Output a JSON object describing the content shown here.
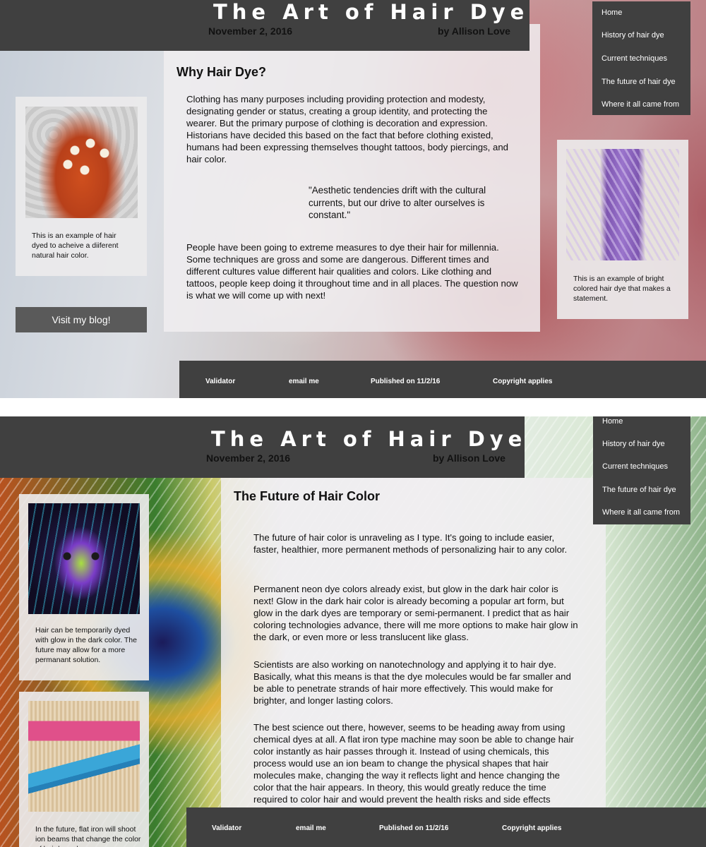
{
  "shot1": {
    "header": {
      "title": "The Art of Hair Dye",
      "date": "November 2, 2016",
      "author": "by Allison Love"
    },
    "nav": {
      "items": [
        "Home",
        "History of hair dye",
        "Current techniques",
        "The future of hair dye",
        "Where it all came from"
      ]
    },
    "left_card": {
      "caption": "This is an example of hair dyed to acheive a diiferent natural hair color."
    },
    "blog_button": "Visit my blog!",
    "main": {
      "title": "Why Hair Dye?",
      "para1": "Clothing has many purposes including providing protection and modesty, designating gender or status, creating a group identity, and protecting the wearer. But the primary purpose of clothing is decoration and expression. Historians have decided this based on the fact that before clothing existed, humans had been expressing themselves thought tattoos, body piercings, and hair color.",
      "quote": "\"Aesthetic tendencies drift with the cultural currents, but our drive to alter ourselves is constant.\"",
      "para2": "People have been going to extreme measures to dye their hair for millennia. Some techniques are gross and some are dangerous. Different times and different cultures value different hair qualities and colors. Like clothing and tattoos, people keep doing it throughout time and in all places. The question now is what we will come up with next!"
    },
    "right_card": {
      "caption": "This is an example of bright colored hair dye that makes a statement."
    },
    "footer": {
      "links": [
        "Validator",
        "email me",
        "Published on 11/2/16",
        "Copyright applies"
      ]
    }
  },
  "shot2": {
    "header": {
      "title": "The Art of Hair Dye",
      "date": "November 2, 2016",
      "author": "by Allison Love"
    },
    "nav": {
      "items": [
        "Home",
        "History of hair dye",
        "Current techniques",
        "The future of hair dye",
        "Where it all came from"
      ]
    },
    "card1": {
      "caption": "Hair can be temporarily dyed with glow in the dark color. The future may allow for a more permanant solution."
    },
    "card2": {
      "caption": "In the future, flat iron will shoot ion beams that change the color of hair based on"
    },
    "main": {
      "title": "The Future of Hair Color",
      "para1": "The future of hair color is unraveling as I type. It's going to include easier, faster, healthier, more permanent methods of personalizing hair to any color.",
      "para2": "Permanent neon dye colors already exist, but glow in the dark hair color is next! Glow in the dark hair color is already becoming a popular art form, but glow in the dark dyes are temporary or semi-permanent. I predict that as hair coloring technologies advance, there will me more options to make hair glow in the dark, or even more or less translucent like glass.",
      "para3": "Scientists are also working on nanotechnology and applying it to hair dye. Basically, what this means is that the dye molecules would be far smaller and be able to penetrate strands of hair more effectively. This would make for brighter, and longer lasting colors.",
      "para4": "The best science out there, however, seems to be heading away from using chemical dyes at all. A flat iron type machine may soon be able to change hair color instantly as hair passes through it. Instead of using chemicals, this process would use an ion beam to change the physical shapes that hair molecules make, changing the way it reflects light and hence changing the color that the hair appears. In theory, this would greatly reduce the time required to color hair and would prevent the health risks and side effects associated with conventional chemical dyes."
    },
    "footer": {
      "links": [
        "Validator",
        "email me",
        "Published on 11/2/16",
        "Copyright applies"
      ]
    }
  }
}
